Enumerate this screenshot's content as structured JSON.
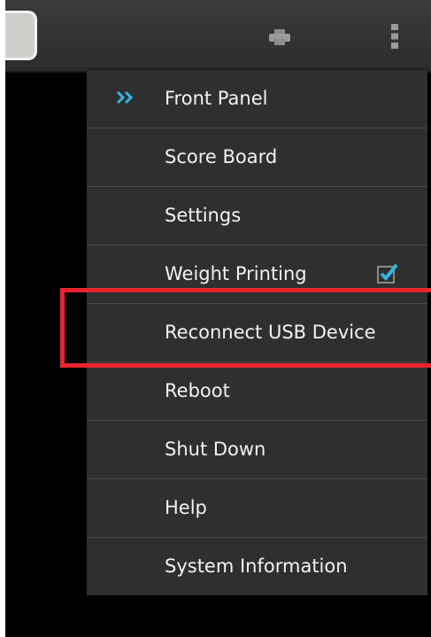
{
  "action_bar": {
    "app_icon": "app-icon",
    "print_icon": "print-icon",
    "overflow_icon": "overflow-menu-icon"
  },
  "menu": {
    "items": [
      {
        "label": "Front Panel",
        "active": true,
        "icon": "double-chevron-right-icon"
      },
      {
        "label": "Score Board"
      },
      {
        "label": "Settings"
      },
      {
        "label": "Weight Printing",
        "checked": true
      },
      {
        "label": "Reconnect USB Device"
      },
      {
        "label": "Reboot"
      },
      {
        "label": "Shut Down"
      },
      {
        "label": "Help"
      },
      {
        "label": "System Information"
      }
    ]
  },
  "colors": {
    "accent": "#33b5e5",
    "highlight_box": "#e8252e",
    "menu_background": "#2f2f2f",
    "menu_text": "#f2f2f2"
  }
}
